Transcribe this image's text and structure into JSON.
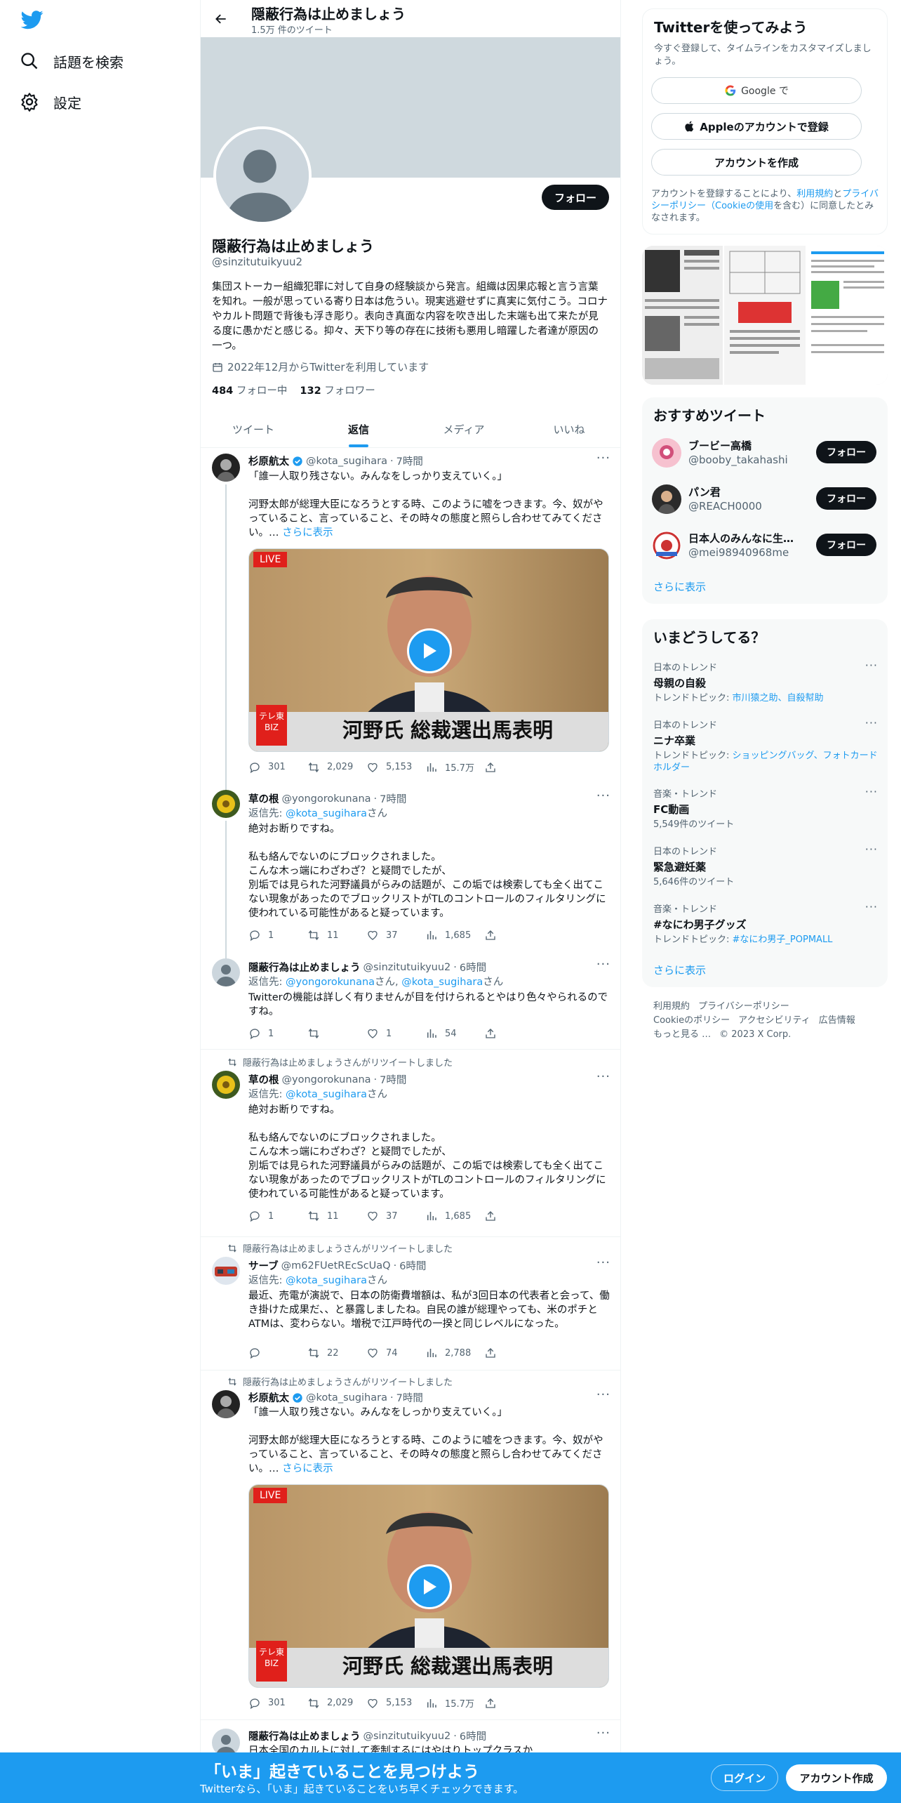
{
  "nav": {
    "explore": "話題を検索",
    "settings": "設定"
  },
  "header": {
    "title": "隠蔽行為は止めましょう",
    "tweet_count": "1.5万 件のツイート"
  },
  "profile": {
    "follow": "フォロー",
    "name": "隠蔽行為は止めましょう",
    "handle": "@sinzitutuikyuu2",
    "bio": "集団ストーカー組織犯罪に対して自身の経験談から発言。組織は因果応報と言う言葉を知れ。一般が思っている寄り日本は危うい。現実逃避せずに真実に気付こう。コロナやカルト問題で背後も浮き彫り。表向き真面な内容を吹き出した末端も出て来たが見る度に愚かだと感じる。抑々、天下り等の存在に技術も悪用し暗躍した者達が原因の一つ。",
    "joined": "2022年12月からTwitterを利用しています",
    "following_count": "484",
    "following_label": "フォロー中",
    "followers_count": "132",
    "followers_label": "フォロワー"
  },
  "tabs": [
    "ツイート",
    "返信",
    "メディア",
    "いいね"
  ],
  "common": {
    "more": "さらに表示",
    "reply_to": "返信先:",
    "san": "さん",
    "sep": "·"
  },
  "tweets": [
    {
      "name": "杉原航太",
      "handle": "@kota_sugihara",
      "time": "7時間",
      "text1": "「誰一人取り残さない。みんなをしっかり支えていく。」",
      "text2": "河野太郎が総理大臣になろうとする時、このように嘘をつきます。今、奴がやっていること、言っていること、その時々の態度と照らし合わせてみてください。…",
      "media": {
        "live": "LIVE",
        "corner": "テレ東BIZ",
        "caption": "河野氏 総裁選出馬表明"
      },
      "replies": "301",
      "retweets": "2,029",
      "likes": "5,153",
      "views": "15.7万"
    },
    {
      "name": "草の根",
      "handle": "@yongorokunana",
      "time": "7時間",
      "reply_to": "@kota_sugihara",
      "text1": "絶対お断りですね。",
      "text2": "私も絡んでないのにブロックされました。\nこんな木っ端にわざわざ？と疑問でしたが、\n別垢では見られた河野議員がらみの話題が、この垢では検索しても全く出てこない現象があったのでブロックリストがTLのコントロールのフィルタリングに使われている可能性があると疑っています。",
      "replies": "1",
      "retweets": "11",
      "likes": "37",
      "views": "1,685"
    },
    {
      "name": "隠蔽行為は止めましょう",
      "handle": "@sinzitutuikyuu2",
      "time": "6時間",
      "reply_to": "@yongorokunana",
      "reply_to2": "@kota_sugihara",
      "text1": "Twitterの機能は詳しく有りませんが目を付けられるとやはり色々やられるのですね。",
      "replies": "1",
      "retweets": "",
      "likes": "1",
      "views": "54"
    },
    {
      "retweet": "隠蔽行為は止めましょうさんがリツイートしました",
      "name": "草の根",
      "handle": "@yongorokunana",
      "time": "7時間",
      "reply_to": "@kota_sugihara",
      "text1": "絶対お断りですね。",
      "text2": "私も絡んでないのにブロックされました。\nこんな木っ端にわざわざ？と疑問でしたが、\n別垢では見られた河野議員がらみの話題が、この垢では検索しても全く出てこない現象があったのでブロックリストがTLのコントロールのフィルタリングに使われている可能性があると疑っています。",
      "replies": "1",
      "retweets": "11",
      "likes": "37",
      "views": "1,685"
    },
    {
      "retweet": "隠蔽行為は止めましょうさんがリツイートしました",
      "name": "サーブ",
      "handle": "@m62FUetREcScUaQ",
      "time": "6時間",
      "reply_to": "@kota_sugihara",
      "text1": "最近、売電が演説で、日本の防衛費増額は、私が3回日本の代表者と会って、働き掛けた成果だ、、と暴露しましたね。自民の誰が総理やっても、米のポチとATMは、変わらない。増税で江戸時代の一揆と同じレベルになった。",
      "replies": "",
      "retweets": "22",
      "likes": "74",
      "views": "2,788"
    },
    {
      "retweet": "隠蔽行為は止めましょうさんがリツイートしました",
      "name": "杉原航太",
      "handle": "@kota_sugihara",
      "time": "7時間",
      "text1": "「誰一人取り残さない。みんなをしっかり支えていく。」",
      "text2": "河野太郎が総理大臣になろうとする時、このように嘘をつきます。今、奴がやっていること、言っていること、その時々の態度と照らし合わせてみてください。…",
      "media": {
        "live": "LIVE",
        "corner": "テレ東BIZ",
        "caption": "河野氏 総裁選出馬表明"
      },
      "replies": "301",
      "retweets": "2,029",
      "likes": "5,153",
      "views": "15.7万"
    },
    {
      "name": "隠蔽行為は止めましょう",
      "handle": "@sinzitutuikyuu2",
      "time": "6時間",
      "text1": "日本全国のカルトに対して牽制するにはやはりトップクラスか"
    }
  ],
  "signup": {
    "title": "Twitterを使ってみよう",
    "subtitle": "今すぐ登録して、タイムラインをカスタマイズしましょう。",
    "google": "Google で",
    "apple": "Appleのアカウントで登録",
    "create": "アカウントを作成",
    "terms_1": "アカウントを登録することにより、",
    "terms_link1": "利用規約",
    "terms_2": "と",
    "terms_link2": "プライバシーポリシー（Cookieの使用",
    "terms_3": "を含む）に同意したとみなされます。"
  },
  "recommended": {
    "title": "おすすめツイート",
    "users": [
      {
        "name": "ブービー高橋",
        "handle": "@booby_takahashi",
        "follow": "フォロー"
      },
      {
        "name": "パン君",
        "handle": "@REACH0000",
        "follow": "フォロー"
      },
      {
        "name": "日本人のみんなに生…",
        "handle": "@mei98940968me",
        "follow": "フォロー"
      }
    ],
    "more": "さらに表示"
  },
  "trends": {
    "title": "いまどうしてる？",
    "items": [
      {
        "context": "日本のトレンド",
        "name": "母親の自殺",
        "meta_label": "トレンドトピック:",
        "meta_links": "市川猿之助、自殺幇助"
      },
      {
        "context": "日本のトレンド",
        "name": "ニナ卒業",
        "meta_label": "トレンドトピック:",
        "meta_links": "ショッピングバッグ、フォトカードホルダー"
      },
      {
        "context": "音楽・トレンド",
        "name": "FC動画",
        "meta": "5,549件のツイート"
      },
      {
        "context": "日本のトレンド",
        "name": "緊急避妊薬",
        "meta": "5,646件のツイート"
      },
      {
        "context": "音楽・トレンド",
        "name": "#なにわ男子グッズ",
        "meta_label": "トレンドトピック:",
        "meta_links": "#なにわ男子_POPMALL"
      }
    ],
    "more": "さらに表示"
  },
  "footer": {
    "line1a": "利用規約",
    "line1b": "プライバシーポリシー",
    "line2a": "Cookieのポリシー",
    "line2b": "アクセシビリティ",
    "line2c": "広告情報",
    "line3a": "もっと見る …",
    "line3b": "© 2023 X Corp."
  },
  "bottombar": {
    "title": "「いま」起きていることを見つけよう",
    "subtitle": "Twitterなら、「いま」起きていることをいち早くチェックできます。",
    "login": "ログイン",
    "signup": "アカウント作成"
  },
  "colors": {
    "accent": "#1d9bf0",
    "text": "#0f1419",
    "muted": "#536471",
    "verified": "#1d9bf0"
  }
}
